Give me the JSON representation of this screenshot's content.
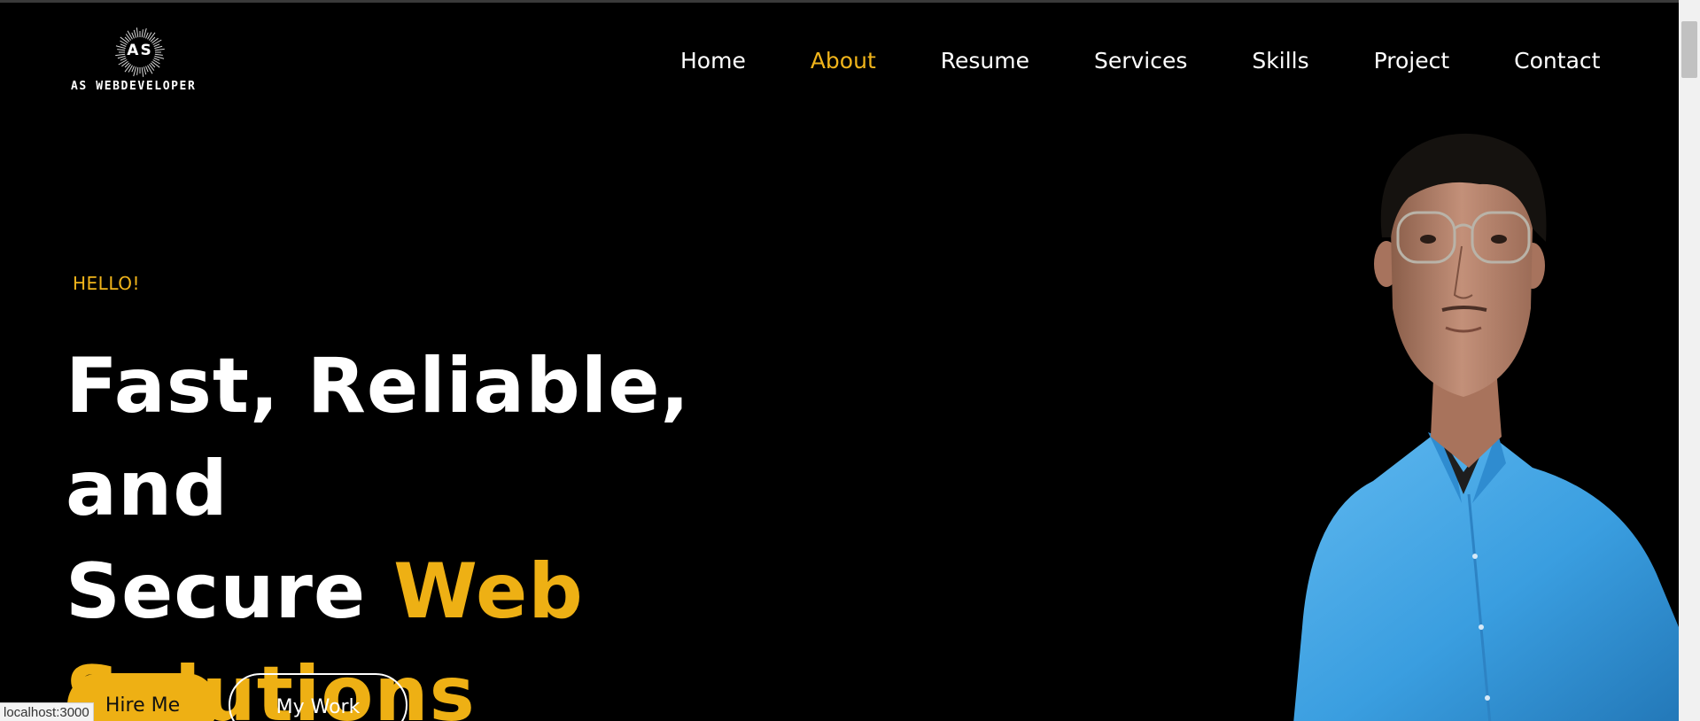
{
  "logo": {
    "monogram": "AS",
    "text": "AS WEBDEVELOPER"
  },
  "nav": {
    "items": [
      {
        "label": "Home",
        "active": false
      },
      {
        "label": "About",
        "active": true
      },
      {
        "label": "Resume",
        "active": false
      },
      {
        "label": "Services",
        "active": false
      },
      {
        "label": "Skills",
        "active": false
      },
      {
        "label": "Project",
        "active": false
      },
      {
        "label": "Contact",
        "active": false
      }
    ]
  },
  "hero": {
    "greeting": "HELLO!",
    "headline_line1": "Fast, Reliable, and",
    "headline_line2_white": "Secure ",
    "headline_line2_yellow": "Web",
    "headline_line3_yellow": "Solutions",
    "hire_label": "Hire Me",
    "work_label": "My Work"
  },
  "status_bar": {
    "url": "localhost:3000"
  },
  "colors": {
    "accent": "#eeb014",
    "background": "#000000",
    "text": "#ffffff"
  }
}
